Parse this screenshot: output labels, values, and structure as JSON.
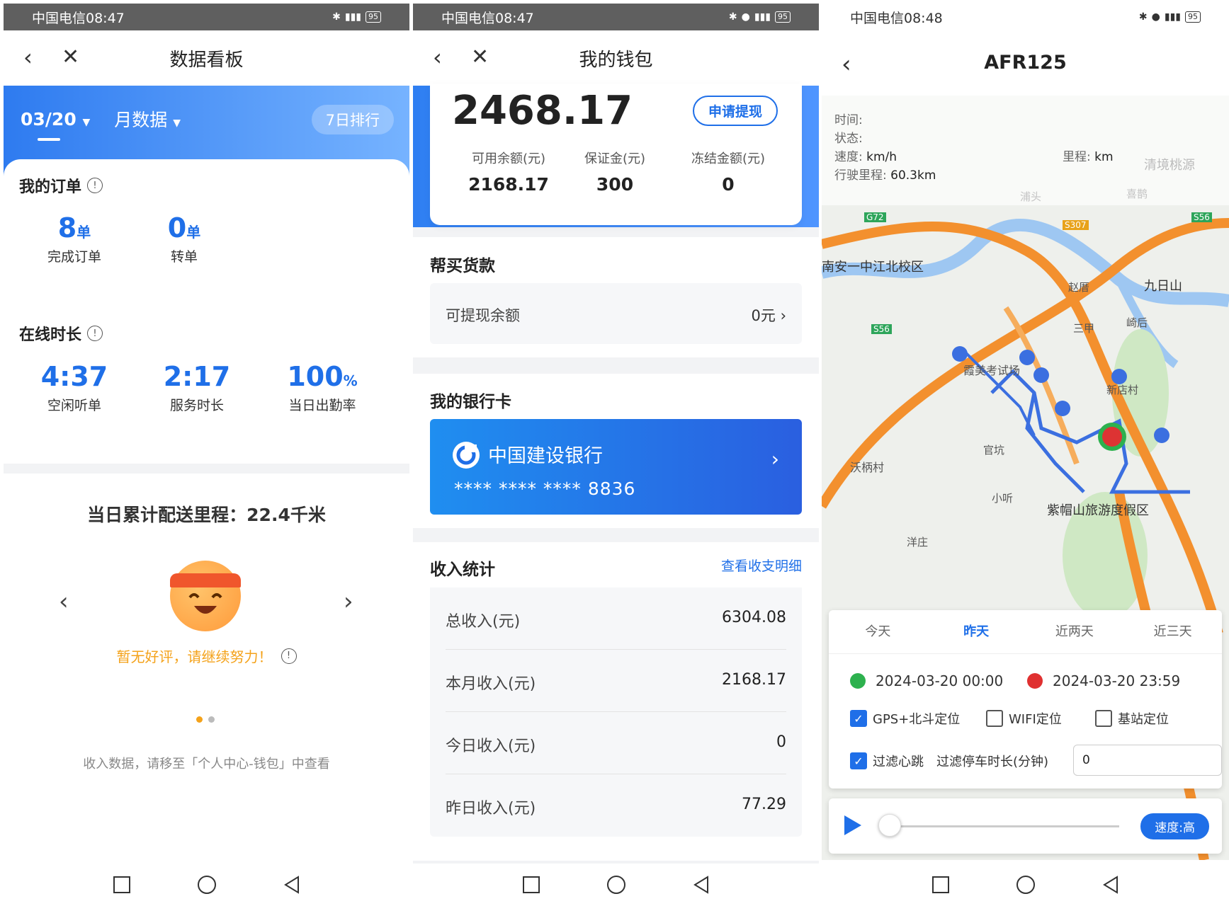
{
  "status_bar": {
    "p1": {
      "carrier_time": "中国电信08:47",
      "battery": "95"
    },
    "p2": {
      "carrier_time": "中国电信08:47",
      "battery": "95"
    },
    "p3": {
      "carrier_time": "中国电信08:48",
      "battery": "95"
    }
  },
  "dashboard": {
    "title": "数据看板",
    "date": "03/20",
    "period": "月数据",
    "rank_button": "7日排行",
    "orders_title": "我的订单",
    "orders": [
      {
        "value": "8",
        "unit": "单",
        "label": "完成订单"
      },
      {
        "value": "0",
        "unit": "单",
        "label": "转单"
      }
    ],
    "online_title": "在线时长",
    "online": [
      {
        "value": "4:37",
        "unit": "",
        "label": "空闲听单"
      },
      {
        "value": "2:17",
        "unit": "",
        "label": "服务时长"
      },
      {
        "value": "100",
        "unit": "%",
        "label": "当日出勤率"
      }
    ],
    "mileage": "当日累计配送里程：22.4千米",
    "review": "暂无好评，请继续努力！",
    "hint": "收入数据，请移至「个人中心-钱包」中查看"
  },
  "wallet": {
    "title": "我的钱包",
    "balance": "2468.17",
    "withdraw_button": "申请提现",
    "accounts": [
      {
        "label": "可用余额(元)",
        "value": "2168.17"
      },
      {
        "label": "保证金(元)",
        "value": "300"
      },
      {
        "label": "冻结金额(元)",
        "value": "0"
      }
    ],
    "purchase_title": "帮买货款",
    "withdrawable_label": "可提现余额",
    "withdrawable_value": "0元",
    "bank_title": "我的银行卡",
    "bank_name": "中国建设银行",
    "bank_number": "**** **** **** 8836",
    "income_title": "收入统计",
    "detail_link": "查看收支明细",
    "income": [
      {
        "label": "总收入(元)",
        "value": "6304.08"
      },
      {
        "label": "本月收入(元)",
        "value": "2168.17"
      },
      {
        "label": "今日收入(元)",
        "value": "0"
      },
      {
        "label": "昨日收入(元)",
        "value": "77.29"
      }
    ]
  },
  "track": {
    "title": "AFR125",
    "info": {
      "time_label": "时间:",
      "status_label": "状态:",
      "speed_label": "速度:",
      "speed_unit": "km/h",
      "mileage_label": "里程:",
      "mileage_unit": "km",
      "driven_label": "行驶里程:",
      "driven_value": "60.3km"
    },
    "map_labels": {
      "school": "南安一中江北校区",
      "mountain": "九日山",
      "resort": "紫帽山旅游度假区",
      "village": "沃柄村",
      "town1": "浦头",
      "town2": "赵厝",
      "town3": "官坑",
      "town4": "新店村",
      "town5": "喜鹊",
      "town6": "清境桃源",
      "town7": "霞美考试场",
      "town8": "三甲",
      "town9": "崎后",
      "town10": "洋庄",
      "town11": "小听",
      "road1": "G72",
      "road2": "S307",
      "road3": "S56",
      "road4": "S56"
    },
    "tabs": [
      "今天",
      "昨天",
      "近两天",
      "近三天"
    ],
    "active_tab": "昨天",
    "start_time": "2024-03-20 00:00",
    "end_time": "2024-03-20 23:59",
    "options": [
      {
        "label": "GPS+北斗定位",
        "checked": true
      },
      {
        "label": "WIFI定位",
        "checked": false
      },
      {
        "label": "基站定位",
        "checked": false
      }
    ],
    "filter_heartbeat": "过滤心跳",
    "filter_stop_label": "过滤停车时长(分钟)",
    "filter_stop_value": "0",
    "speed_button": "速度:高"
  }
}
